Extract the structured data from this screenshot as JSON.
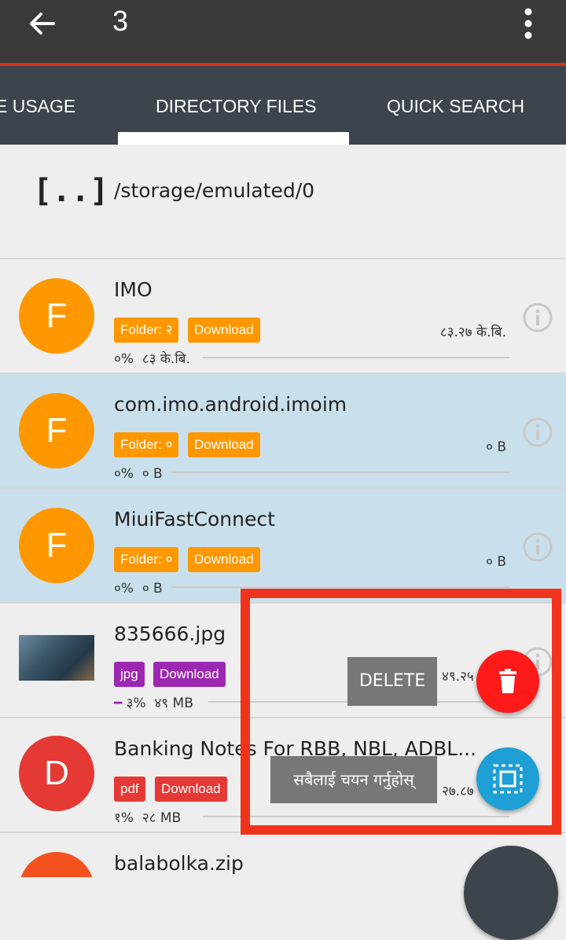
{
  "header": {
    "title": "3"
  },
  "tabs": [
    {
      "label": "E USAGE"
    },
    {
      "label": "DIRECTORY FILES"
    },
    {
      "label": "QUICK SEARCH"
    }
  ],
  "parent": {
    "icon": "[..]",
    "path": "/storage/emulated/0"
  },
  "items": [
    {
      "avatar": "F",
      "name": "IMO",
      "type_badge": "Folder: २",
      "download": "Download",
      "size": "८३.२७ के.बि.",
      "percent": "०%",
      "progress_size": "८३ के.बि.",
      "selected": false
    },
    {
      "avatar": "F",
      "name": "com.imo.android.imoim",
      "type_badge": "Folder: ०",
      "download": "Download",
      "size": "० B",
      "percent": "०%",
      "progress_size": "० B",
      "selected": true
    },
    {
      "avatar": "F",
      "name": "MiuiFastConnect",
      "type_badge": "Folder: ०",
      "download": "Download",
      "size": "० B",
      "percent": "०%",
      "progress_size": "० B",
      "selected": true
    },
    {
      "name": "835666.jpg",
      "type_badge": "jpg",
      "download": "Download",
      "size": "४९.२५",
      "percent": "३%",
      "progress_size": "४९ MB",
      "selected": false
    },
    {
      "avatar": "D",
      "name": "Banking Notes For RBB, NBL, ADBL...",
      "type_badge": "pdf",
      "download": "Download",
      "size": "२७.८७",
      "percent": "१%",
      "progress_size": "२८ MB",
      "selected": false
    },
    {
      "name": "balabolka.zip"
    }
  ],
  "actions": {
    "delete_label": "DELETE",
    "select_all_label": "सबैलाई चयन गर्नुहोस्"
  },
  "colors": {
    "folder_orange": "#ff9800",
    "jpg_purple": "#9c27b0",
    "pdf_red": "#e53935",
    "delete_fab": "#ff1a1a",
    "select_fab": "#1e9fd6",
    "highlight": "#f0341c"
  }
}
